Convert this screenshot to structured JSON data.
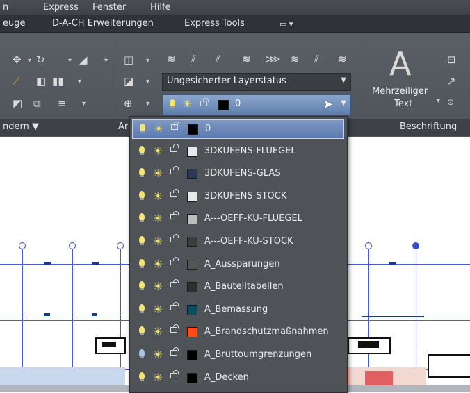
{
  "menubar": {
    "items": [
      "n",
      "Express",
      "Fenster",
      "Hilfe"
    ]
  },
  "tabs": {
    "items": [
      "euge",
      "D-A-CH Erweiterungen",
      "Express Tools"
    ]
  },
  "ribbon": {
    "layer_status": "Ungesicherter Layerstatus",
    "current_layer": "0",
    "multiline_text": "Mehrzeiliger",
    "multiline_text2": "Text",
    "big_a": "A"
  },
  "panels": {
    "modify": "ndern ▼",
    "layers_partial": "Ar",
    "annotation": "Beschriftung"
  },
  "colors": {
    "accent": "#6a86b8",
    "dropdown_bg": "#4f5256",
    "drawing_lines": "#4a5bd0"
  },
  "layers": [
    {
      "name": "0",
      "color": "#000000",
      "bulb": "#f4e27a",
      "selected": true
    },
    {
      "name": "3DKUFENS-FLUEGEL",
      "color": "#e8e8e8",
      "bulb": "#f4e27a",
      "selected": false
    },
    {
      "name": "3DKUFENS-GLAS",
      "color": "#2a3a55",
      "bulb": "#f4e27a",
      "selected": false
    },
    {
      "name": "3DKUFENS-STOCK",
      "color": "#e8e8e8",
      "bulb": "#f4e27a",
      "selected": false
    },
    {
      "name": "A---OEFF-KU-FLUEGEL",
      "color": "#bdbdbd",
      "bulb": "#f4e27a",
      "selected": false
    },
    {
      "name": "A---OEFF-KU-STOCK",
      "color": "#3c3c3c",
      "bulb": "#f4e27a",
      "selected": false
    },
    {
      "name": "A_Aussparungen",
      "color": "#555555",
      "bulb": "#f4e27a",
      "selected": false
    },
    {
      "name": "A_Bauteiltabellen",
      "color": "#2f2f2f",
      "bulb": "#f4e27a",
      "selected": false
    },
    {
      "name": "A_Bemassung",
      "color": "#0f4d5e",
      "bulb": "#f4e27a",
      "selected": false
    },
    {
      "name": "A_Brandschutzmaßnahmen",
      "color": "#ff4a1a",
      "bulb": "#f4e27a",
      "selected": false
    },
    {
      "name": "A_Bruttoumgrenzungen",
      "color": "#000000",
      "bulb": "#a9c4e8",
      "selected": false
    },
    {
      "name": "A_Decken",
      "color": "#000000",
      "bulb": "#f4e27a",
      "selected": false
    }
  ]
}
